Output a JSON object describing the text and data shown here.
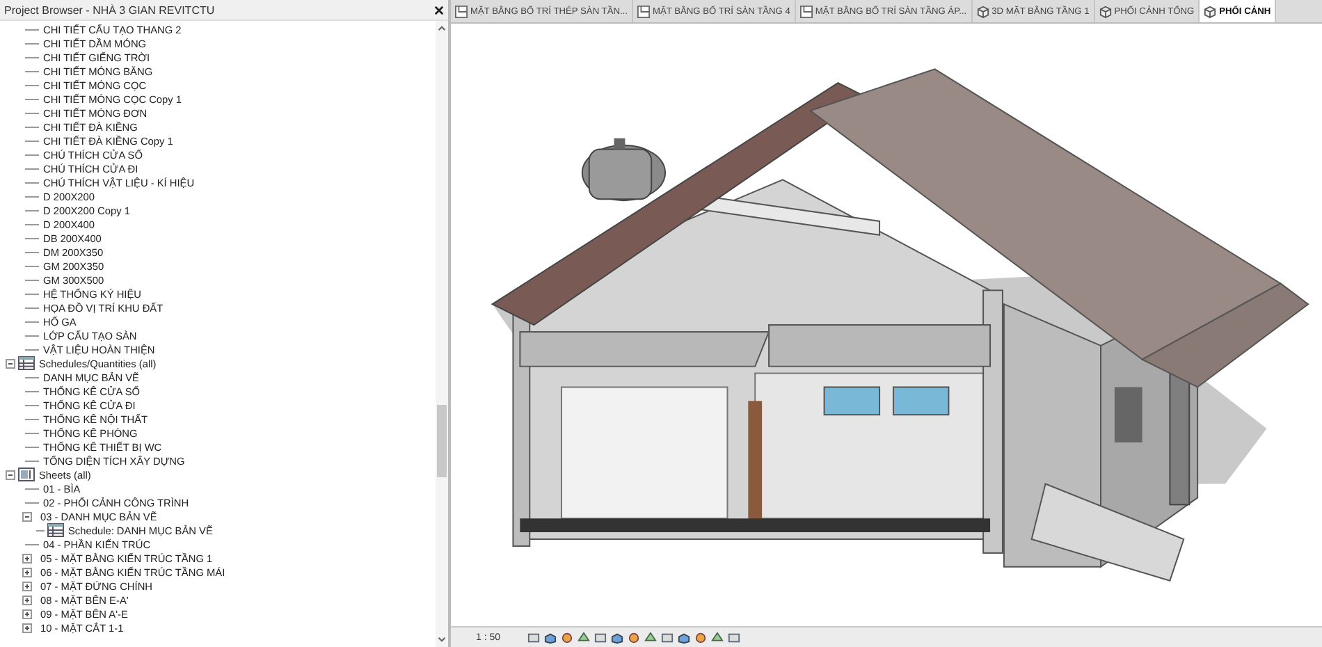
{
  "project_browser": {
    "title": "Project Browser - NHÀ 3 GIAN REVITCTU",
    "continued_items": [
      {
        "label": "CHI TIẾT CẤU TẠO THANG 2"
      },
      {
        "label": "CHI TIẾT DẦM MÓNG"
      },
      {
        "label": "CHI TIẾT GIẾNG TRỜI"
      },
      {
        "label": "CHI TIẾT MÓNG BĂNG"
      },
      {
        "label": "CHI TIẾT MÓNG CỌC"
      },
      {
        "label": "CHI TIẾT MÓNG CỌC Copy 1"
      },
      {
        "label": "CHI TIẾT MÓNG ĐƠN"
      },
      {
        "label": "CHI TIẾT ĐÀ KIỀNG"
      },
      {
        "label": "CHI TIẾT ĐÀ KIỀNG Copy 1"
      },
      {
        "label": "CHÚ THÍCH CỬA SỔ"
      },
      {
        "label": "CHÚ THÍCH CỬA ĐI"
      },
      {
        "label": "CHÚ THÍCH VẬT LIỆU - KÍ HIỆU"
      },
      {
        "label": "D 200X200"
      },
      {
        "label": "D 200X200 Copy 1"
      },
      {
        "label": "D 200X400"
      },
      {
        "label": "DB 200X400"
      },
      {
        "label": "DM 200X350"
      },
      {
        "label": "GM 200X350"
      },
      {
        "label": "GM 300X500"
      },
      {
        "label": "HỆ THỐNG KÝ HIỆU"
      },
      {
        "label": "HỌA ĐỒ VỊ TRÍ KHU ĐẤT"
      },
      {
        "label": "HỐ GA"
      },
      {
        "label": "LỚP CẤU TẠO SÀN"
      },
      {
        "label": "VẬT LIỆU HOÀN THIỆN"
      }
    ],
    "groups": [
      {
        "label": "Schedules/Quantities (all)",
        "kind": "schedules",
        "expanded": true,
        "children": [
          {
            "label": "DANH MỤC BẢN VẼ"
          },
          {
            "label": "THỐNG KÊ CỬA SỔ"
          },
          {
            "label": "THỐNG KÊ CỬA ĐI"
          },
          {
            "label": "THỐNG KÊ NỘI THẤT"
          },
          {
            "label": "THỐNG KÊ PHÒNG"
          },
          {
            "label": "THỐNG KÊ THIẾT BỊ WC"
          },
          {
            "label": "TỔNG DIỆN TÍCH XÂY DỰNG"
          }
        ]
      },
      {
        "label": "Sheets (all)",
        "kind": "sheets",
        "expanded": true,
        "children": [
          {
            "label": "01 - BÌA"
          },
          {
            "label": "02 - PHỐI CẢNH CÔNG TRÌNH"
          },
          {
            "label": "03 - DANH MỤC BẢN VẼ",
            "expanded": true,
            "children": [
              {
                "label": "Schedule: DANH MỤC BẢN VẼ",
                "kind": "schedule"
              }
            ]
          },
          {
            "label": "04 - PHẦN KIẾN TRÚC"
          },
          {
            "label": "05 - MẶT BẰNG KIẾN TRÚC TẦNG 1",
            "expanded": false
          },
          {
            "label": "06 - MẶT BẰNG KIẾN TRÚC TẦNG MÁI",
            "expanded": false
          },
          {
            "label": "07 - MẶT ĐỨNG CHÍNH",
            "expanded": false
          },
          {
            "label": "08 - MẶT BÊN E-A'",
            "expanded": false
          },
          {
            "label": "09 - MẶT BÊN A'-E",
            "expanded": false
          },
          {
            "label": "10 - MẶT CẮT 1-1",
            "expanded": false
          }
        ]
      }
    ]
  },
  "tabs": [
    {
      "label": "MẶT BẰNG BỐ TRÍ THÉP SÀN TẦN...",
      "kind": "plan",
      "selected": false
    },
    {
      "label": "MẶT BẰNG BỐ TRÍ SÀN TẦNG 4",
      "kind": "plan",
      "selected": false
    },
    {
      "label": "MẶT BẰNG BỐ TRÍ SÀN TẦNG ÁP...",
      "kind": "plan",
      "selected": false
    },
    {
      "label": "3D MẶT BẰNG TẦNG 1",
      "kind": "perspective",
      "selected": false
    },
    {
      "label": "PHỐI CẢNH TỔNG",
      "kind": "perspective",
      "selected": false
    },
    {
      "label": "PHỐI CẢNH",
      "kind": "perspective",
      "selected": true
    }
  ],
  "status_bar": {
    "scale": "1 : 50"
  }
}
